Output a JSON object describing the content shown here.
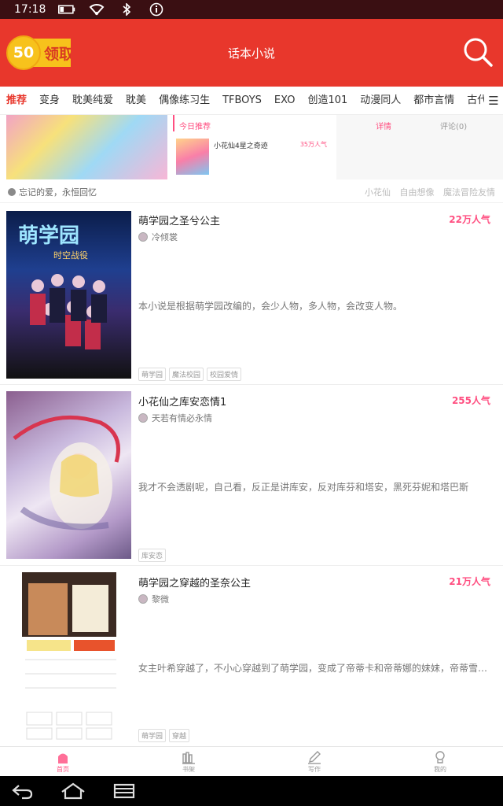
{
  "status_bar": {
    "time": "17:18"
  },
  "header": {
    "title": "话本小说",
    "coin_value": "50",
    "coin_label": "领取"
  },
  "tabs": [
    "推荐",
    "变身",
    "耽美纯爱",
    "耽美",
    "偶像练习生",
    "TFBOYS",
    "EXO",
    "创造101",
    "动漫同人",
    "都市言情",
    "古代言情"
  ],
  "banner": {
    "caption": "忘记的爱，永恒回忆",
    "tags": [
      "小花仙",
      "自由想像",
      "魔法冒险友情"
    ],
    "mid_heading": "今日推荐",
    "mid_title": "小花仙4星之奇迹",
    "mid_pop": "35万人气",
    "right_tab1": "详情",
    "right_tab2": "评论(0)"
  },
  "stories": [
    {
      "title": "萌学园之圣兮公主",
      "popularity": "22万人气",
      "author": "冷倾裳",
      "desc": "本小说是根据萌学园改编的，会少人物，多人物，会改变人物。",
      "tags": [
        "萌学园",
        "魔法校园",
        "校园爱情"
      ]
    },
    {
      "title": "小花仙之库安恋情1",
      "popularity": "255人气",
      "author": "天若有情必永情",
      "desc": "我才不会透剧呢，自己看，反正是讲库安，反对库芬和塔安，黑死芬妮和塔巴斯",
      "tags": [
        "库安恋"
      ]
    },
    {
      "title": "萌学园之穿越的圣奈公主",
      "popularity": "21万人气",
      "author": "黎微",
      "desc": "女主叶希穿越了，不小心穿越到了萌学园，变成了帝蒂卡和帝蒂娜的妹妹，帝蒂雪，又一不…",
      "tags": [
        "萌学园",
        "穿越"
      ]
    }
  ],
  "bottom_nav": [
    {
      "label": "首页",
      "icon": "home-icon"
    },
    {
      "label": "书架",
      "icon": "bookshelf-icon"
    },
    {
      "label": "写作",
      "icon": "pencil-icon"
    },
    {
      "label": "我的",
      "icon": "profile-icon"
    }
  ],
  "colors": {
    "header": "#e8372c",
    "accent": "#ff4f81",
    "coin": "#f7c21c"
  }
}
